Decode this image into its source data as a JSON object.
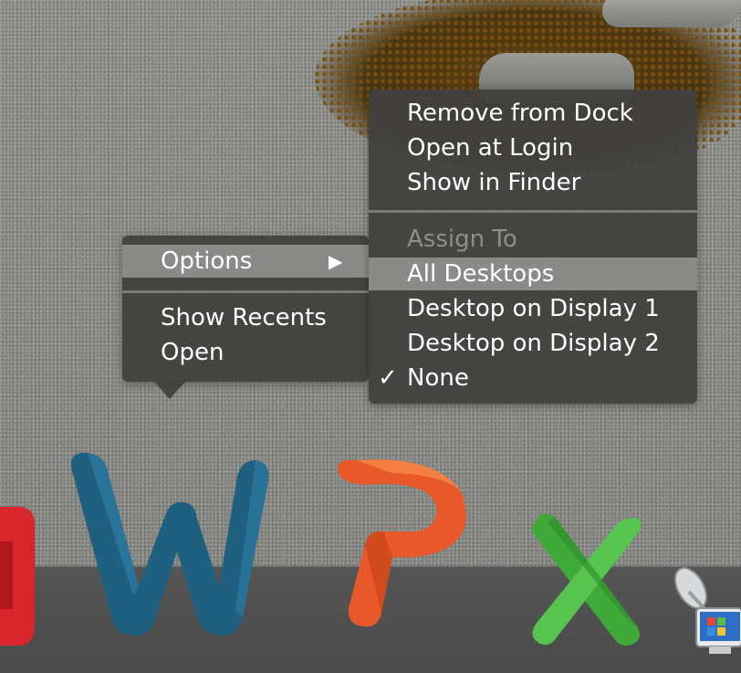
{
  "context_menu": {
    "items": [
      {
        "label": "Options",
        "submenu_arrow": "▶"
      },
      {
        "label": "Show Recents"
      },
      {
        "label": "Open"
      }
    ]
  },
  "options_submenu": {
    "top_items": [
      {
        "label": "Remove from Dock"
      },
      {
        "label": "Open at Login"
      },
      {
        "label": "Show in Finder"
      }
    ],
    "assign_to": {
      "header": "Assign To",
      "items": [
        {
          "label": "All Desktops",
          "highlighted": true
        },
        {
          "label": "Desktop on Display 1"
        },
        {
          "label": "Desktop on Display 2"
        },
        {
          "label": "None",
          "checked": true,
          "checkmark": "✓"
        }
      ]
    }
  },
  "dock": {
    "apps": [
      {
        "icon": "red-app-icon"
      },
      {
        "icon": "word-w-icon",
        "color": "#1f5f80"
      },
      {
        "icon": "powerpoint-p-icon",
        "color": "#e8582a"
      },
      {
        "icon": "excel-x-icon",
        "color": "#3faa3a"
      },
      {
        "icon": "remote-desktop-satellite-icon"
      }
    ]
  },
  "colors": {
    "menu_bg": "#40403e",
    "highlight": "#8a8b88",
    "disabled_text": "#8e8e8c"
  }
}
